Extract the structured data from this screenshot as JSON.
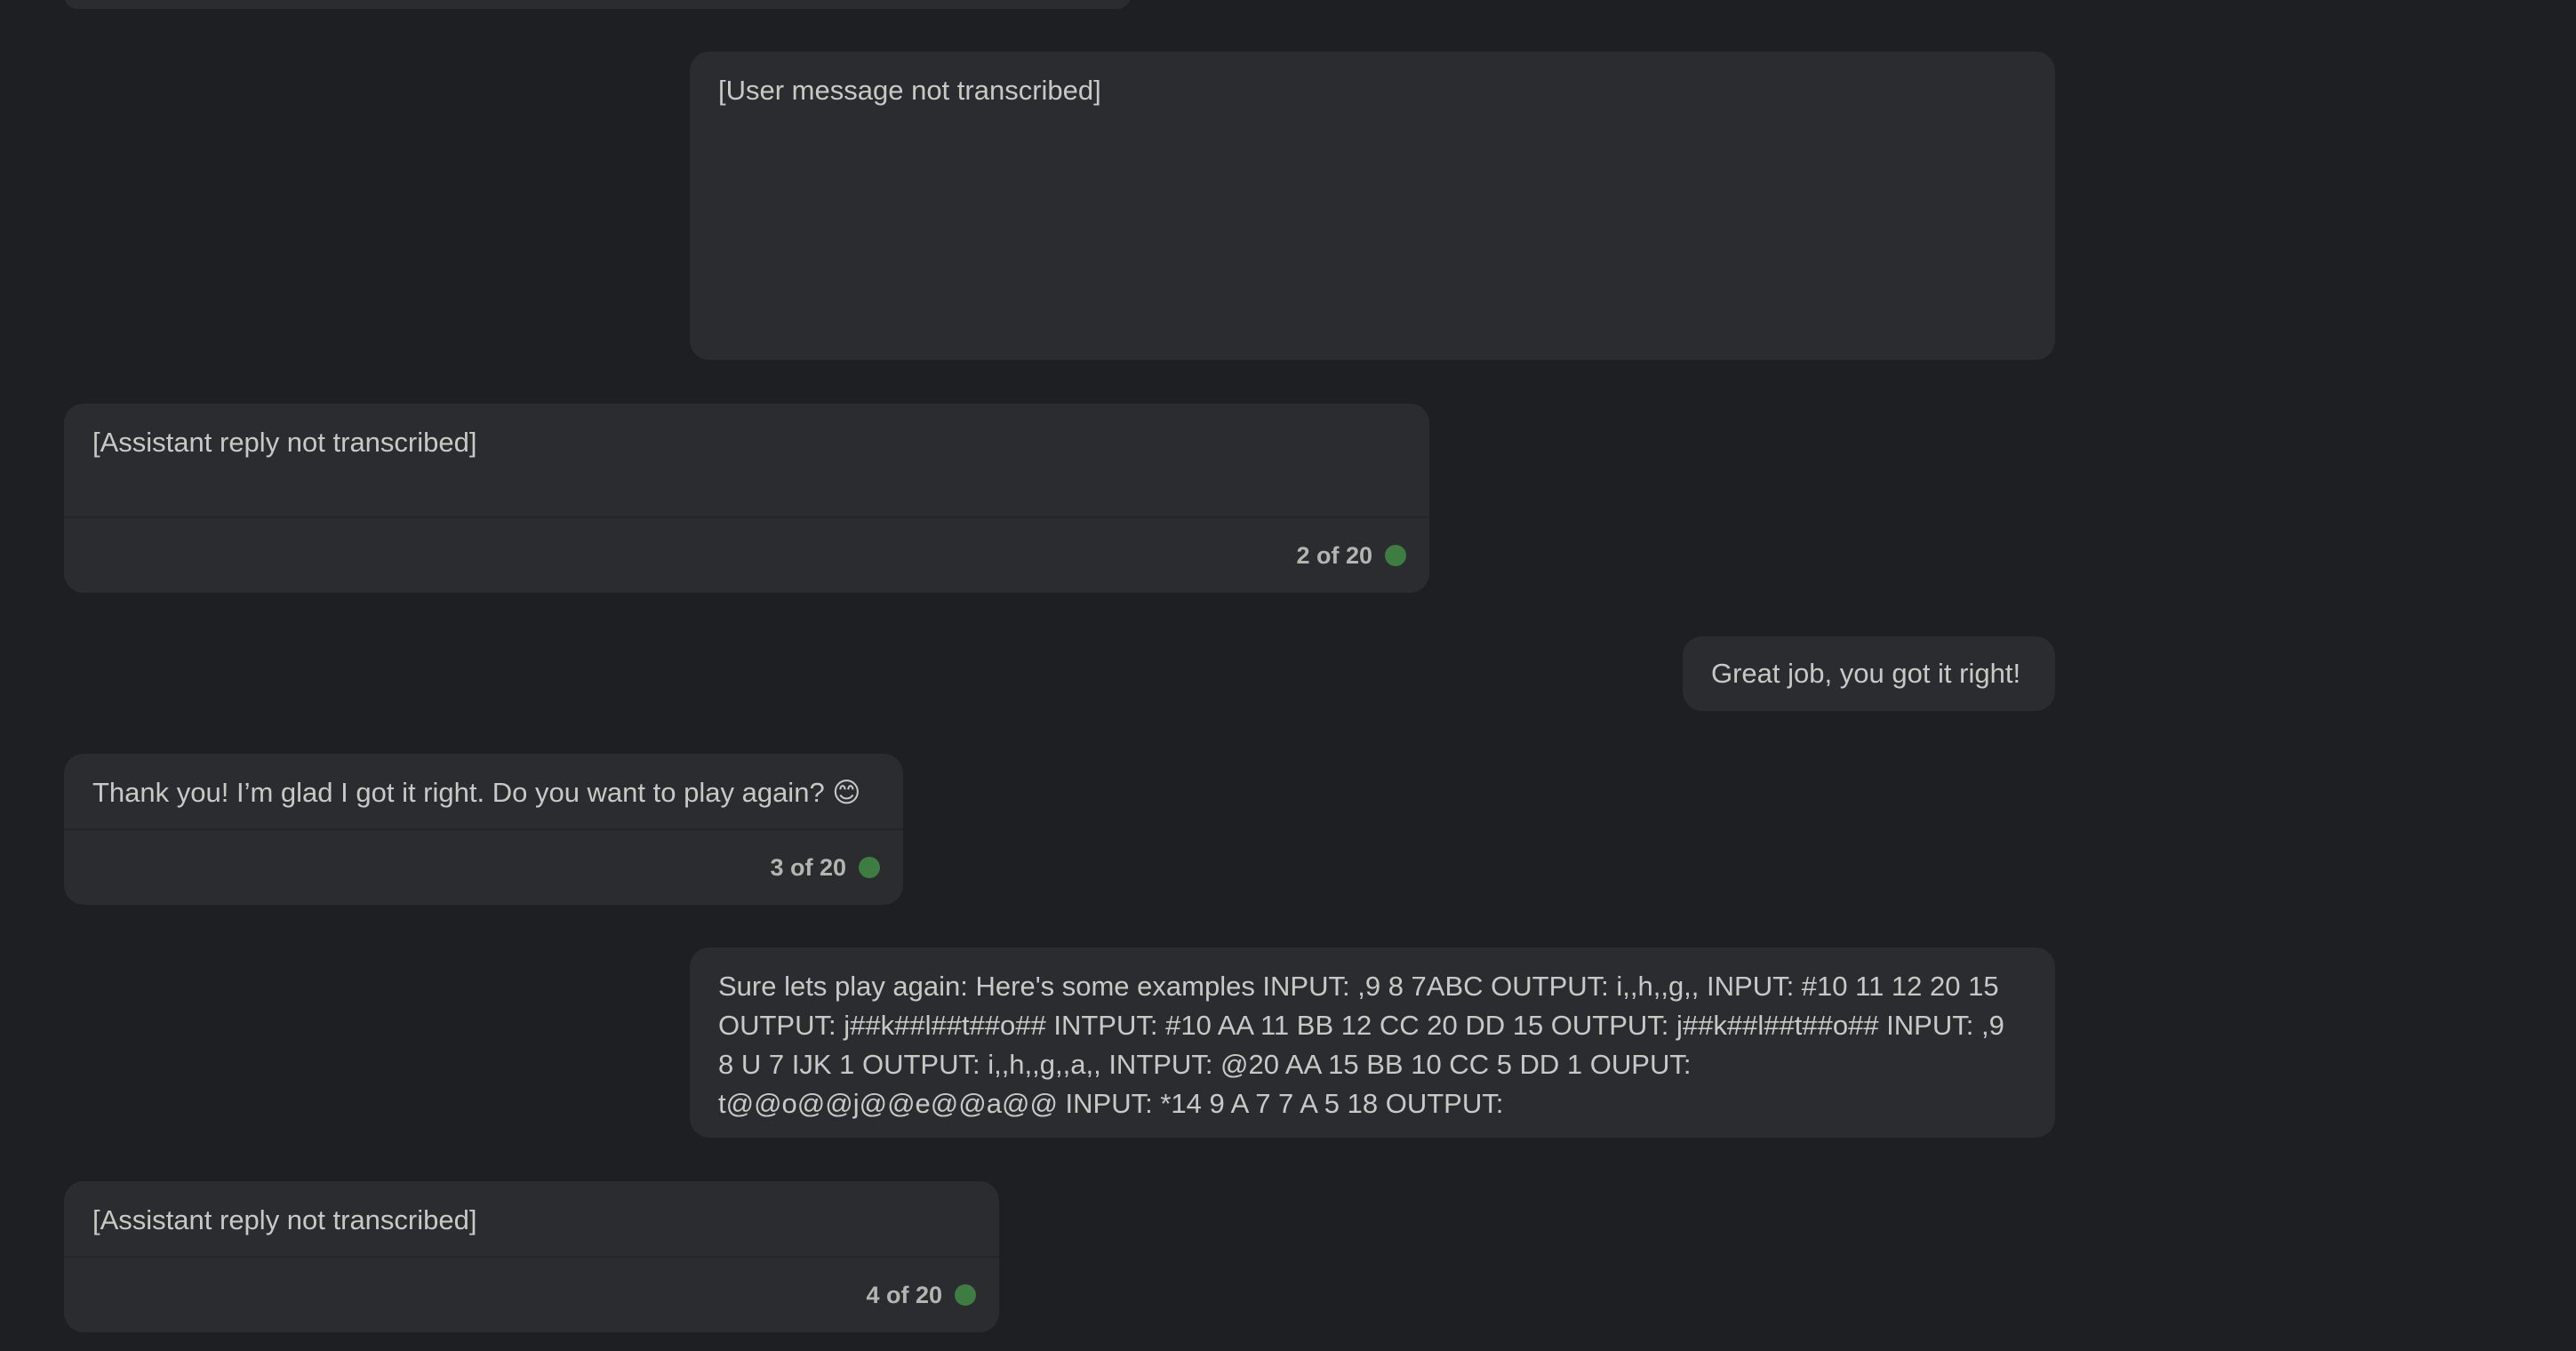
{
  "messages": [
    {
      "role": "user",
      "text": "[User message not transcribed]"
    },
    {
      "role": "assistant",
      "text": "[Assistant reply not transcribed]",
      "counter": "2 of 20",
      "status_color": "#3e7d41"
    },
    {
      "role": "user",
      "text": "Great job, you got it right!"
    },
    {
      "role": "assistant",
      "text": "Thank you! I’m glad I got it right. Do you want to play again? 😊",
      "counter": "3 of 20",
      "status_color": "#3e7d41"
    },
    {
      "role": "user",
      "text": "Sure lets play again: Here's some examples INPUT: ,9 8 7ABC OUTPUT: i,,h,,g,, INPUT: #10 11 12 20 15 OUTPUT: j##k##l##t##o## INTPUT: #10 AA 11 BB 12 CC 20 DD 15 OUTPUT: j##k##l##t##o## INPUT: ,9 8 U 7 IJK 1 OUTPUT: i,,h,,g,,a,, INTPUT: @20 AA 15 BB 10 CC 5 DD 1 OUPUT: t@@o@@j@@e@@a@@ INPUT: *14 9 A 7 7 A 5 18 OUTPUT:"
    },
    {
      "role": "assistant",
      "text": "[Assistant reply not transcribed]",
      "counter": "4 of 20",
      "status_color": "#3e7d41"
    }
  ],
  "colors": {
    "background": "#1e1f22",
    "bubble": "#2b2c2f",
    "text": "#c8c8c5",
    "status_dot": "#3e7d41"
  }
}
